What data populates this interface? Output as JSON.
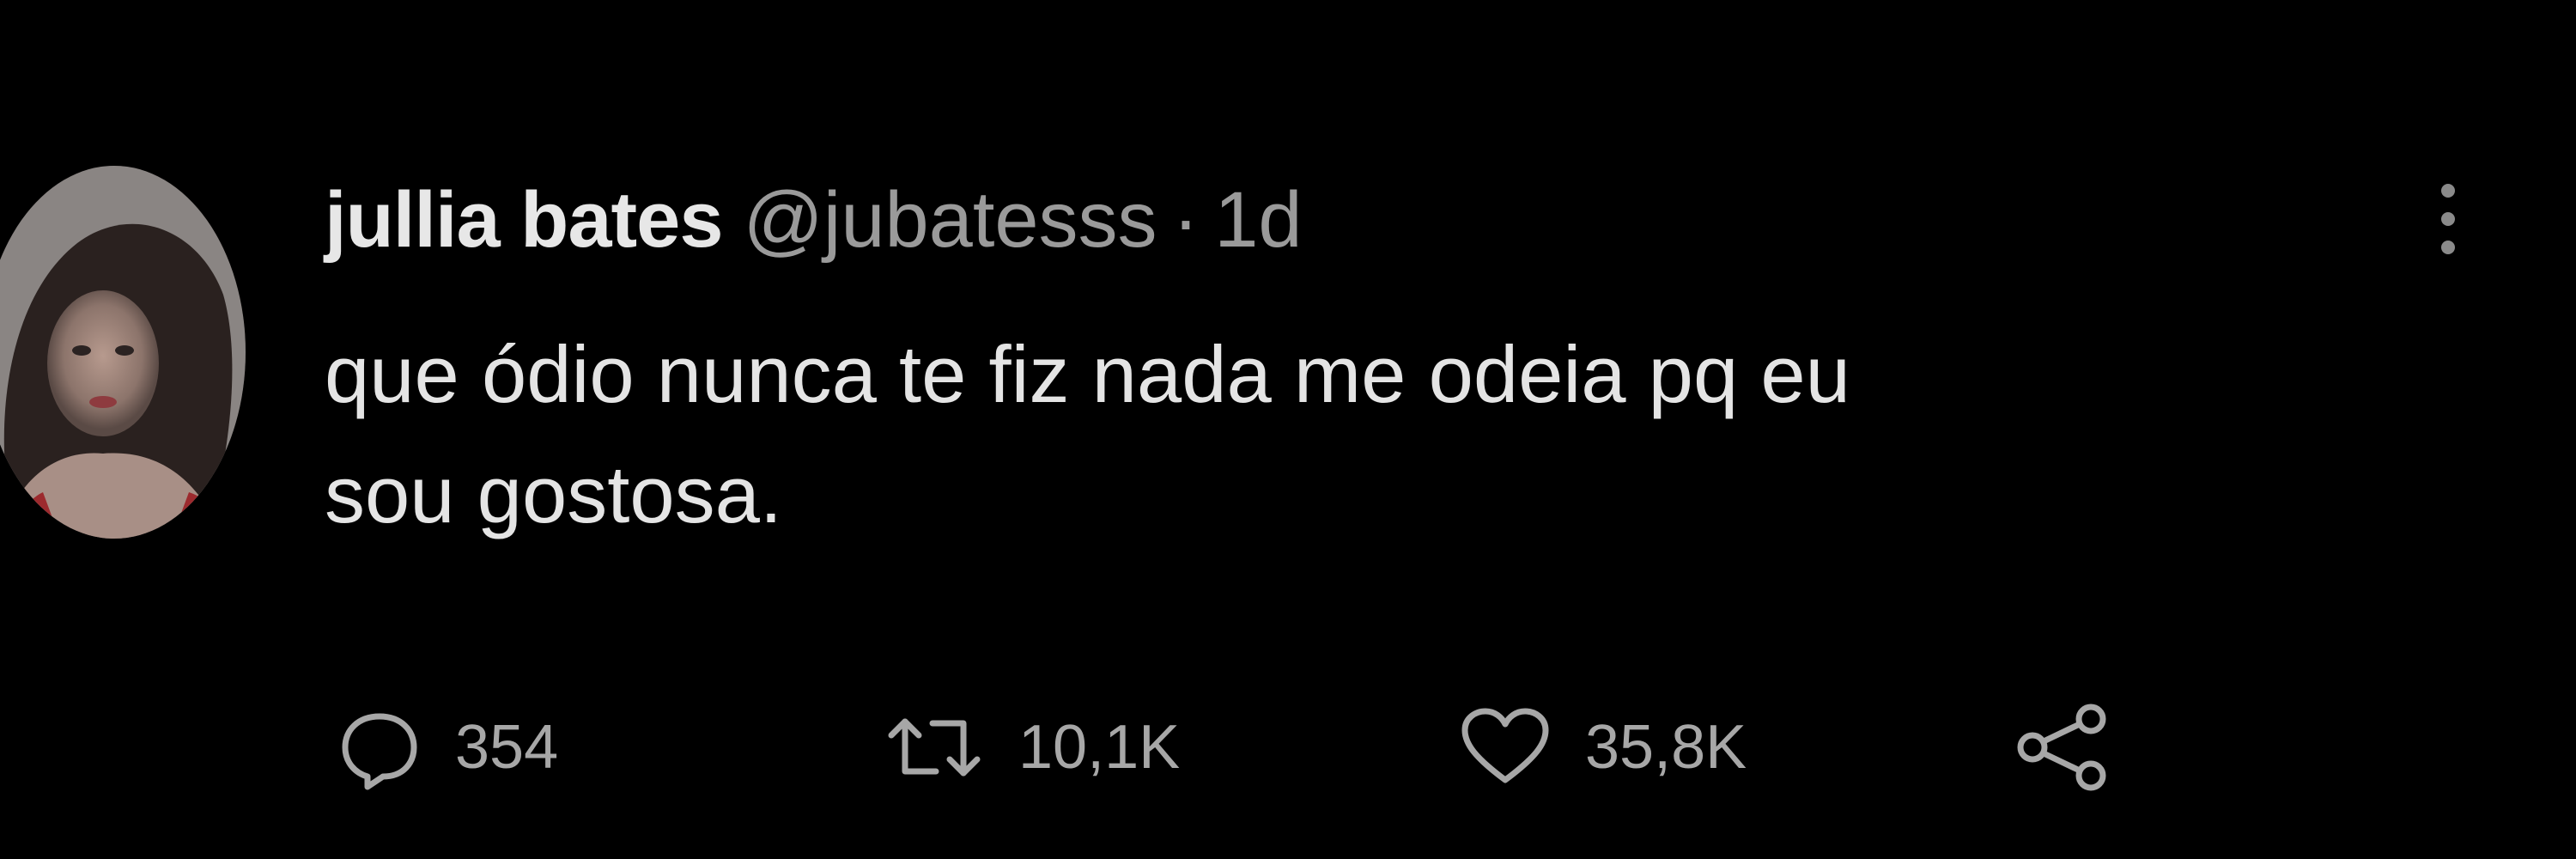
{
  "tweet": {
    "author": {
      "display_name": "jullia bates",
      "handle": "@jubatesss",
      "separator": "·",
      "time_ago": "1d",
      "avatar_icon": "user-avatar"
    },
    "text_line1": "que ódio nunca te fiz nada me odeia pq eu",
    "text_line2": "sou gostosa.",
    "metrics": {
      "replies": "354",
      "retweets": "10,1K",
      "likes": "35,8K"
    },
    "icons": {
      "more": "more-vertical-icon",
      "reply": "reply-icon",
      "retweet": "retweet-icon",
      "like": "heart-icon",
      "share": "share-icon"
    },
    "colors": {
      "background": "#000000",
      "text": "#e4e4e4",
      "secondary": "#9a9a9a"
    }
  }
}
